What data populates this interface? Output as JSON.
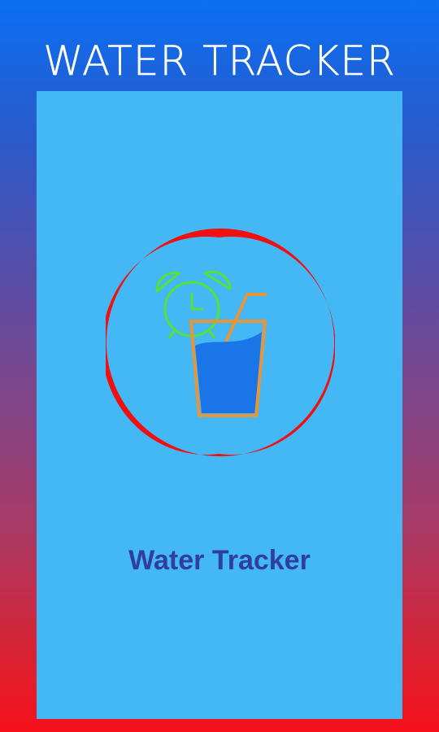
{
  "banner": {
    "title": "WATER TRACKER"
  },
  "splash": {
    "app_name": "Water Tracker",
    "logo": {
      "icons": [
        "alarm-clock-icon",
        "water-glass-icon",
        "straw-icon"
      ],
      "colors": {
        "ring": "#f01010",
        "clock": "#55e03a",
        "glass_outline": "#e8953a",
        "water": "#1a76e8"
      }
    }
  },
  "colors": {
    "background_top": "#0a6ff2",
    "background_bottom": "#f5101a",
    "screen": "#44b8f5",
    "app_name_text": "#2f3f9e"
  }
}
